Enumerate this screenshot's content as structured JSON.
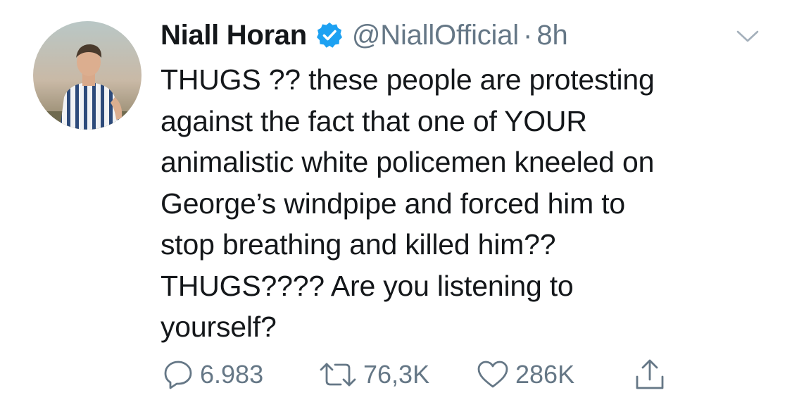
{
  "user": {
    "display_name": "Niall Horan",
    "handle": "@NiallOfficial",
    "separator": "·",
    "time": "8h",
    "verified": true
  },
  "tweet": {
    "lines": [
      "THUGS ?? these people are protesting",
      "against the fact that one of YOUR",
      "animalistic white policemen kneeled on",
      "George’s windpipe and forced him to",
      "stop breathing and killed him??",
      "THUGS???? Are you listening to",
      "yourself?"
    ]
  },
  "actions": {
    "reply": {
      "icon": "reply-icon",
      "count": "6.983"
    },
    "retweet": {
      "icon": "retweet-icon",
      "count": "76,3K"
    },
    "like": {
      "icon": "heart-icon",
      "count": "286K"
    },
    "share": {
      "icon": "share-icon",
      "count": ""
    }
  },
  "colors": {
    "text": "#14171a",
    "secondary": "#657786",
    "verified": "#1da1f2",
    "background": "#ffffff"
  }
}
